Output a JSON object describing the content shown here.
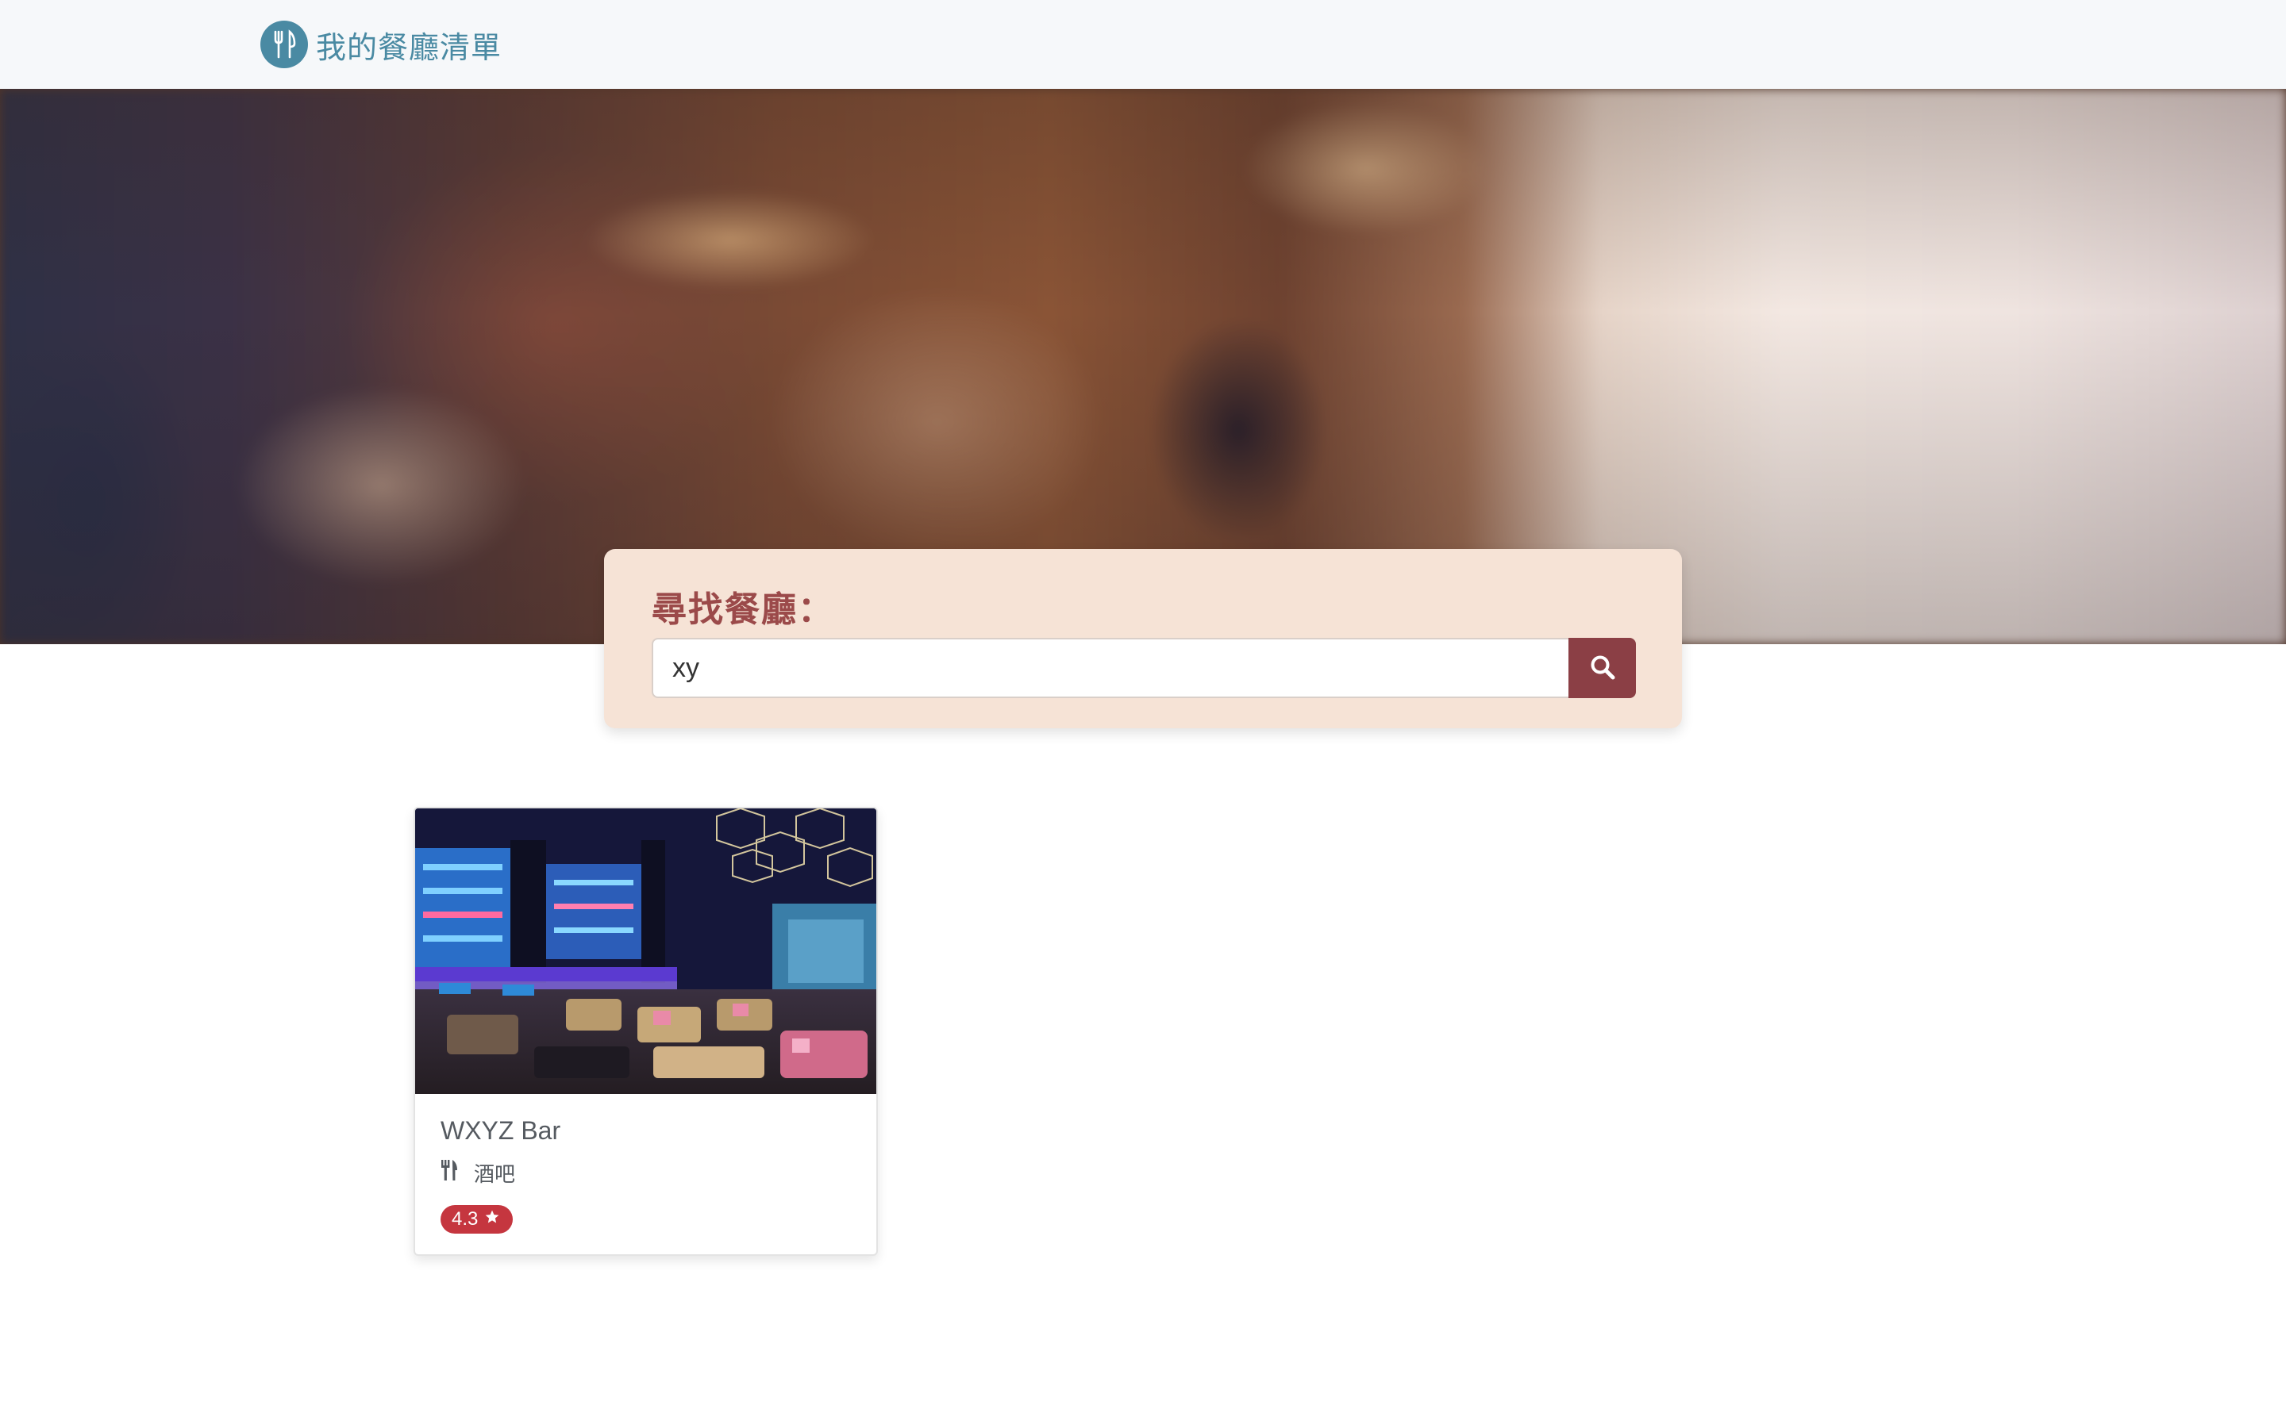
{
  "navbar": {
    "brand_name": "我的餐廳清單",
    "brand_icon": "fork-knife-icon",
    "background": "#f6f8fa",
    "accent": "#4a8aa3"
  },
  "search": {
    "title": "尋找餐廳：",
    "query": "xy",
    "button_icon": "search-icon",
    "panel_color": "#f6e3d6",
    "button_color": "#8b3f45"
  },
  "restaurants": [
    {
      "name": "WXYZ Bar",
      "category": "酒吧",
      "category_icon": "utensils-icon",
      "rating": "4.3",
      "rating_icon": "star-icon",
      "badge_color": "#c5363f"
    }
  ]
}
